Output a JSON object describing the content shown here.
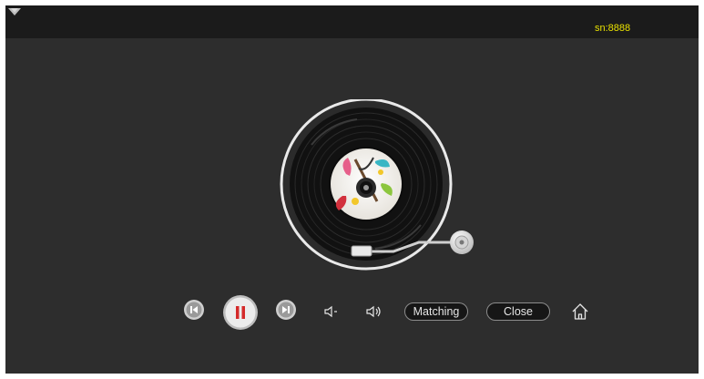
{
  "status_bar": {
    "serial": "sn:8888",
    "wifi_icon": "wifi-icon"
  },
  "player": {
    "state": "playing",
    "record_icon": "vinyl-record",
    "tonearm_icon": "tonearm"
  },
  "controls": {
    "prev_icon": "skip-previous-icon",
    "pause_icon": "pause-icon",
    "next_icon": "skip-next-icon",
    "volume_down_icon": "volume-down-icon",
    "volume_up_icon": "volume-up-icon",
    "matching_label": "Matching",
    "close_label": "Close",
    "home_icon": "home-icon"
  },
  "colors": {
    "background": "#2d2d2d",
    "status_bar": "#1b1b1b",
    "serial_text": "#e8e000",
    "pause_accent": "#d42a2a"
  }
}
